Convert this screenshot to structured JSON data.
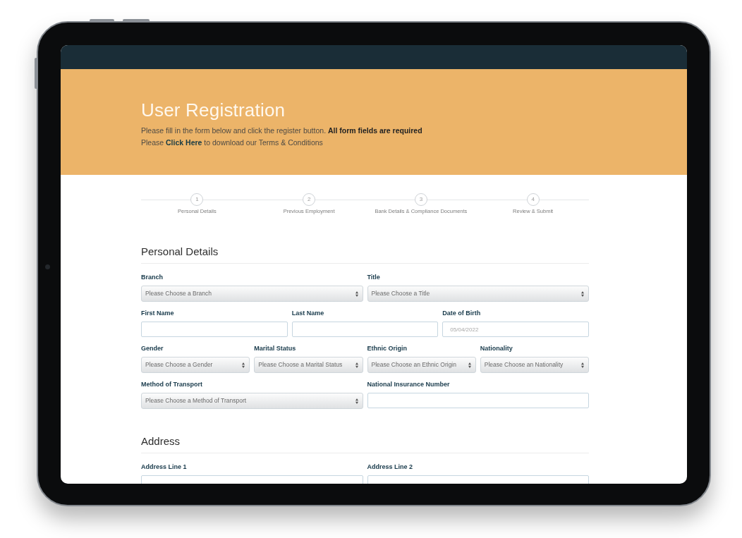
{
  "header": {
    "title": "User Registration",
    "instructions": "Please fill in the form below and click the register button. **All form fields are required**",
    "terms_note": {
      "before": "Please ",
      "link": "Click Here",
      "after": " to download our Terms & Conditions"
    }
  },
  "steps": [
    {
      "number": "1",
      "label": "Personal Details"
    },
    {
      "number": "2",
      "label": "Previous Employment"
    },
    {
      "number": "3",
      "label": "Bank Details & Compliance Documents"
    },
    {
      "number": "4",
      "label": "Review & Submit"
    }
  ],
  "sections": [
    {
      "title": "Personal Details",
      "field_groups": [
        {
          "fields": [
            {
              "kind": "select",
              "label": "Branch",
              "placeholder": "Please Choose a Branch"
            },
            {
              "kind": "select",
              "label": "Title",
              "placeholder": "Please Choose a Title"
            }
          ]
        },
        {
          "fields": [
            {
              "kind": "text",
              "label": "First Name"
            },
            {
              "kind": "text",
              "label": "Last Name"
            },
            {
              "kind": "date",
              "label": "Date of Birth",
              "placeholder": "05/04/2022"
            }
          ]
        },
        {
          "fields": [
            {
              "kind": "select",
              "label": "Gender",
              "placeholder": "Please Choose a Gender"
            },
            {
              "kind": "select",
              "label": "Marital Status",
              "placeholder": "Please Choose a Marital Status"
            },
            {
              "kind": "select",
              "label": "Ethnic Origin",
              "placeholder": "Please Choose an Ethnic Origin"
            },
            {
              "kind": "select",
              "label": "Nationality",
              "placeholder": "Please Choose an Nationality"
            }
          ]
        },
        {
          "fields": [
            {
              "kind": "select",
              "label": "Method of Transport",
              "placeholder": "Please Choose a Method of Transport"
            },
            {
              "kind": "text",
              "label": "National Insurance Number"
            }
          ]
        }
      ]
    },
    {
      "title": "Address",
      "field_groups": [
        {
          "fields": [
            {
              "kind": "text",
              "label": "Address Line 1"
            },
            {
              "kind": "text",
              "label": "Address Line 2"
            }
          ]
        }
      ]
    }
  ]
}
